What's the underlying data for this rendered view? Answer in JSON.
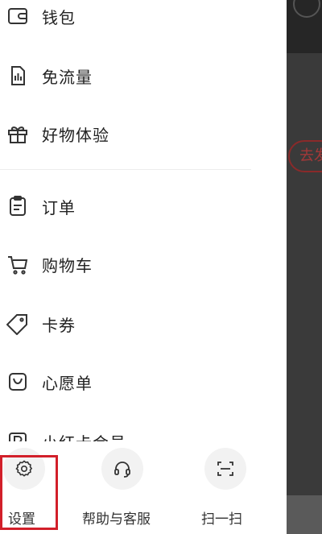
{
  "drawer": {
    "menu_items": [
      {
        "label": "钱包",
        "icon": "wallet-icon"
      },
      {
        "label": "免流量",
        "icon": "data-free-icon"
      },
      {
        "label": "好物体验",
        "icon": "gift-icon"
      },
      {
        "label": "订单",
        "icon": "order-icon"
      },
      {
        "label": "购物车",
        "icon": "cart-icon"
      },
      {
        "label": "卡券",
        "icon": "coupon-icon"
      },
      {
        "label": "心愿单",
        "icon": "wishlist-icon"
      },
      {
        "label": "小红卡会员",
        "icon": "member-card-icon"
      }
    ],
    "bottom_actions": [
      {
        "label": "设置",
        "icon": "gear-icon"
      },
      {
        "label": "帮助与客服",
        "icon": "headset-icon"
      },
      {
        "label": "扫一扫",
        "icon": "scan-icon"
      }
    ]
  },
  "background": {
    "pill_text": "去发"
  },
  "colors": {
    "highlight": "#d21f2a",
    "icon_stroke": "#333333",
    "backdrop": "#3a3a3a"
  }
}
